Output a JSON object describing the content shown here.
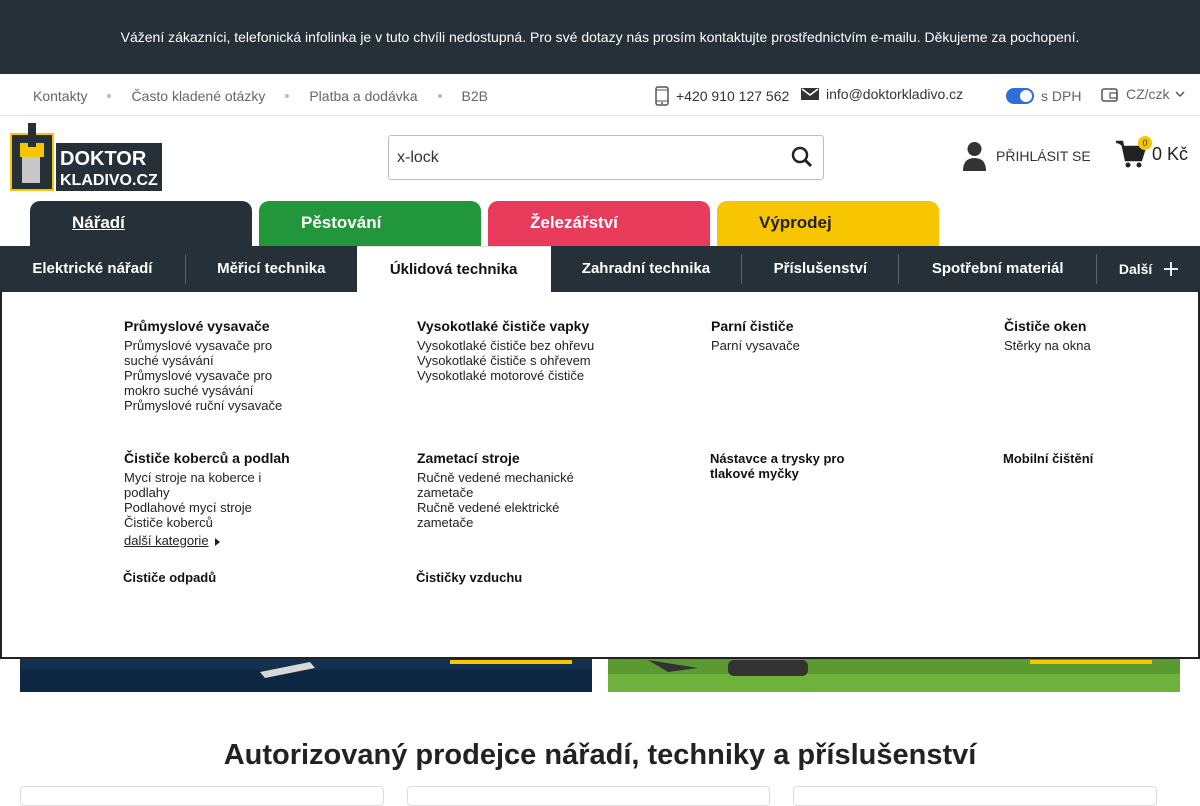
{
  "notice": "Vážení zákazníci, telefonická infolinka je v tuto chvíli nedostupná. Pro své dotazy nás prosím kontaktujte prostřednictvím e-mailu. Děkujeme za pochopení.",
  "topbar": {
    "links": [
      "Kontakty",
      "Často kladené otázky",
      "Platba a dodávka",
      "B2B"
    ],
    "phone": "+420 910 127 562",
    "email": "info@doktorkladivo.cz",
    "vat_toggle": "s DPH",
    "currency": "CZ/czk"
  },
  "header": {
    "logo_text": [
      "DOKTOR",
      "KLADIVO.CZ"
    ],
    "search_value": "x-lock",
    "login": "PŘIHLÁSIT SE",
    "cart_count": "0",
    "cart_price": "0 Kč"
  },
  "categories": [
    {
      "label": "Nářadí",
      "color": "#263038"
    },
    {
      "label": "Pěstování",
      "color": "#21963a"
    },
    {
      "label": "Železářství",
      "color": "#e83a5a"
    },
    {
      "label": "Výprodej",
      "color": "#f7c600"
    }
  ],
  "subnav": [
    "Elektrické nářadí",
    "Měřicí technika",
    "Úklidová technika",
    "Zahradní technika",
    "Příslušenství",
    "Spotřební materiál",
    "Další"
  ],
  "mega": {
    "c1": {
      "title": "Průmyslové vysavače",
      "items": [
        "Průmyslové vysavače pro suché vysávání",
        "Průmyslové vysavače pro mokro suché vysávání",
        "Průmyslové ruční vysavače"
      ]
    },
    "c2": {
      "title": "Vysokotlaké čističe vapky",
      "items": [
        "Vysokotlaké čističe bez ohřevu",
        "Vysokotlaké čističe s ohřevem",
        "Vysokotlaké motorové čističe"
      ]
    },
    "c3": {
      "title": "Parní čističe",
      "items": [
        "Parní vysavače"
      ]
    },
    "c4": {
      "title": "Čističe oken",
      "items": [
        "Stěrky na okna"
      ]
    },
    "c5": {
      "title": "Čističe koberců a podlah",
      "items": [
        "Mycí stroje na koberce i podlahy",
        "Podlahové mycí stroje",
        "Čističe koberců"
      ],
      "more": "další kategorie"
    },
    "c6": {
      "title": "Zametací stroje",
      "items": [
        "Ručně vedené mechanické zametače",
        "Ručně vedené elektrické zametače"
      ]
    },
    "c7": {
      "title": "Nástavce a trysky pro tlakové myčky"
    },
    "c8": {
      "title": "Mobilní čištění"
    },
    "c9": {
      "title": "Čističe odpadů"
    },
    "c10": {
      "title": "Čističky vzduchu"
    }
  },
  "headline": "Autorizovaný prodejce nářadí, techniky a příslušenství"
}
